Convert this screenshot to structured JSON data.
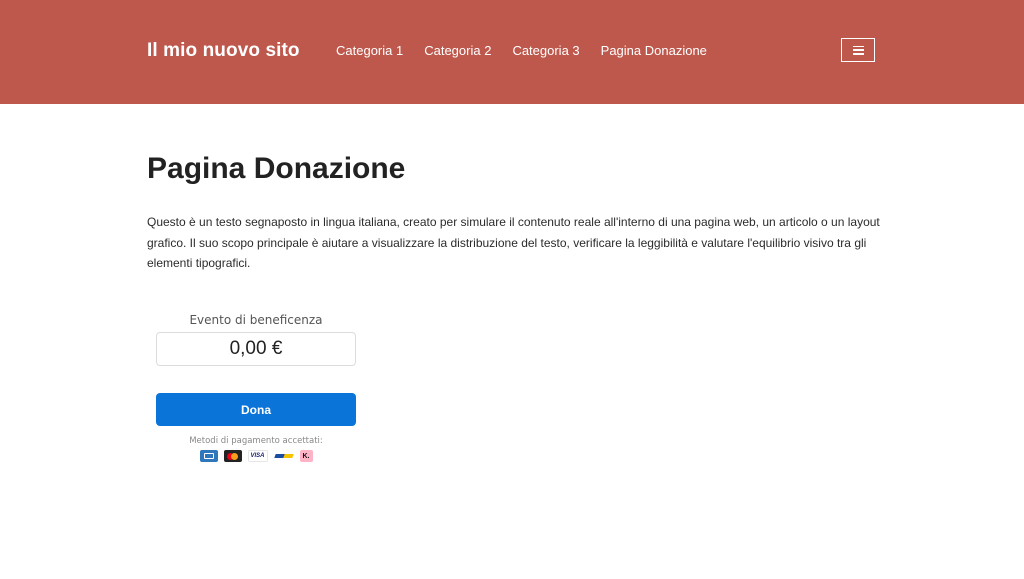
{
  "header": {
    "site_title": "Il mio nuovo sito",
    "nav": [
      "Categoria 1",
      "Categoria 2",
      "Categoria 3",
      "Pagina Donazione"
    ],
    "menu_icon": "hamburger-icon",
    "background_color": "#be584d"
  },
  "main": {
    "title": "Pagina Donazione",
    "intro": "Questo è un testo segnaposto in lingua italiana, creato per simulare il contenuto reale all'interno di una pagina web, un articolo o un layout grafico. Il suo scopo principale è aiutare a visualizzare la distribuzione del testo, verificare la leggibilità e valutare l'equilibrio visivo tra gli elementi tipografici."
  },
  "donation": {
    "event_label": "Evento di beneficenza",
    "amount": "0,00 €",
    "button_label": "Dona",
    "button_color": "#0b74d9",
    "payment_methods_label": "Metodi di pagamento accettati:",
    "payment_methods": [
      "amex-icon",
      "mastercard-icon",
      "visa-icon",
      "bank-transfer-icon",
      "klarna-icon"
    ],
    "visa_text": "VISA",
    "klarna_text": "K."
  }
}
